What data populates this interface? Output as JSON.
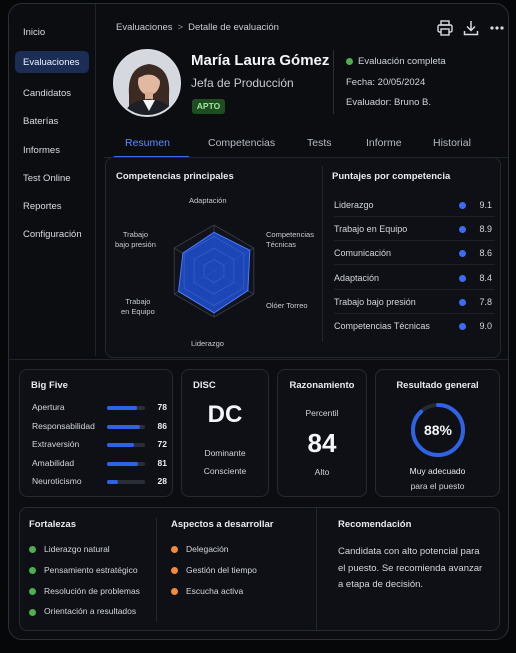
{
  "sidebar": {
    "items": [
      {
        "label": "Inicio"
      },
      {
        "label": "Evaluaciones"
      },
      {
        "label": "Candidatos"
      },
      {
        "label": "Baterías"
      },
      {
        "label": "Informes"
      },
      {
        "label": "Test Online"
      },
      {
        "label": "Reportes"
      },
      {
        "label": "Configuración"
      }
    ],
    "active_index": 1
  },
  "breadcrumb": {
    "parent": "Evaluaciones",
    "separator": ">",
    "current": "Detalle de evaluación"
  },
  "toolbar": {
    "icons": [
      "printer-icon",
      "download-icon",
      "more-icon"
    ]
  },
  "candidate": {
    "name": "María Laura Gómez",
    "role": "Jefa de Producción",
    "badge": "APTO",
    "status": "Evaluación completa",
    "date": "Fecha: 20/05/2024",
    "evaluator": "Evaluador: Bruno B."
  },
  "tabs": [
    "Resumen",
    "Competencias",
    "Tests",
    "Informe",
    "Historial"
  ],
  "active_tab": 0,
  "radar": {
    "title": "Competencias principales",
    "labels": {
      "top": "Adaptación",
      "right_top_1": "Competencias",
      "right_top_2": "Técnicas",
      "right_bottom": "Olóer Torreo",
      "bottom": "Liderazgo",
      "left_bottom_1": "Trabajo",
      "left_bottom_2": "en Equipo",
      "left_top_1": "Trabajo",
      "left_top_2": "bajo presión"
    },
    "values": [
      8.4,
      9.0,
      8.5,
      9.1,
      8.9,
      7.8
    ],
    "max": 10
  },
  "scores": {
    "title": "Puntajes por competencia",
    "rows": [
      {
        "label": "Liderazgo",
        "value": "9.1"
      },
      {
        "label": "Trabajo en Equipo",
        "value": "8.9"
      },
      {
        "label": "Comunicación",
        "value": "8.6"
      },
      {
        "label": "Adaptación",
        "value": "8.4"
      },
      {
        "label": "Trabajo bajo presión",
        "value": "7.8"
      },
      {
        "label": "Competencias Técnicas",
        "value": "9.0"
      }
    ]
  },
  "big_five": {
    "title": "Big Five",
    "rows": [
      {
        "label": "Apertura",
        "value": "78",
        "fraction": 0.78
      },
      {
        "label": "Responsabilidad",
        "value": "86",
        "fraction": 0.86
      },
      {
        "label": "Extraversión",
        "value": "72",
        "fraction": 0.72
      },
      {
        "label": "Amabilidad",
        "value": "81",
        "fraction": 0.81
      },
      {
        "label": "Neuroticismo",
        "value": "28",
        "fraction": 0.28
      }
    ]
  },
  "disc": {
    "title": "DISC",
    "code": "DC",
    "line1": "Dominante",
    "line2": "Consciente"
  },
  "reasoning": {
    "title": "Razonamiento",
    "label": "Percentil",
    "value": "84",
    "level": "Alto"
  },
  "overall": {
    "title": "Resultado general",
    "percent": "88%",
    "fraction": 0.88,
    "line1": "Muy adecuado",
    "line2": "para el puesto"
  },
  "strengths": {
    "title": "Fortalezas",
    "color": "#4caf50",
    "items": [
      "Liderazgo natural",
      "Pensamiento estratégico",
      "Resolución de problemas",
      "Orientación a resultados"
    ]
  },
  "develop": {
    "title": "Aspectos a desarrollar",
    "color": "#f08a3c",
    "items": [
      "Delegación",
      "Gestión del tiempo",
      "Escucha activa"
    ]
  },
  "recommendation": {
    "title": "Recomendación",
    "text": "Candidata con alto potencial para el puesto. Se recomienda avanzar a etapa de decisión."
  },
  "colors": {
    "accent": "#3d6cf0",
    "status_green": "#4caf50"
  }
}
